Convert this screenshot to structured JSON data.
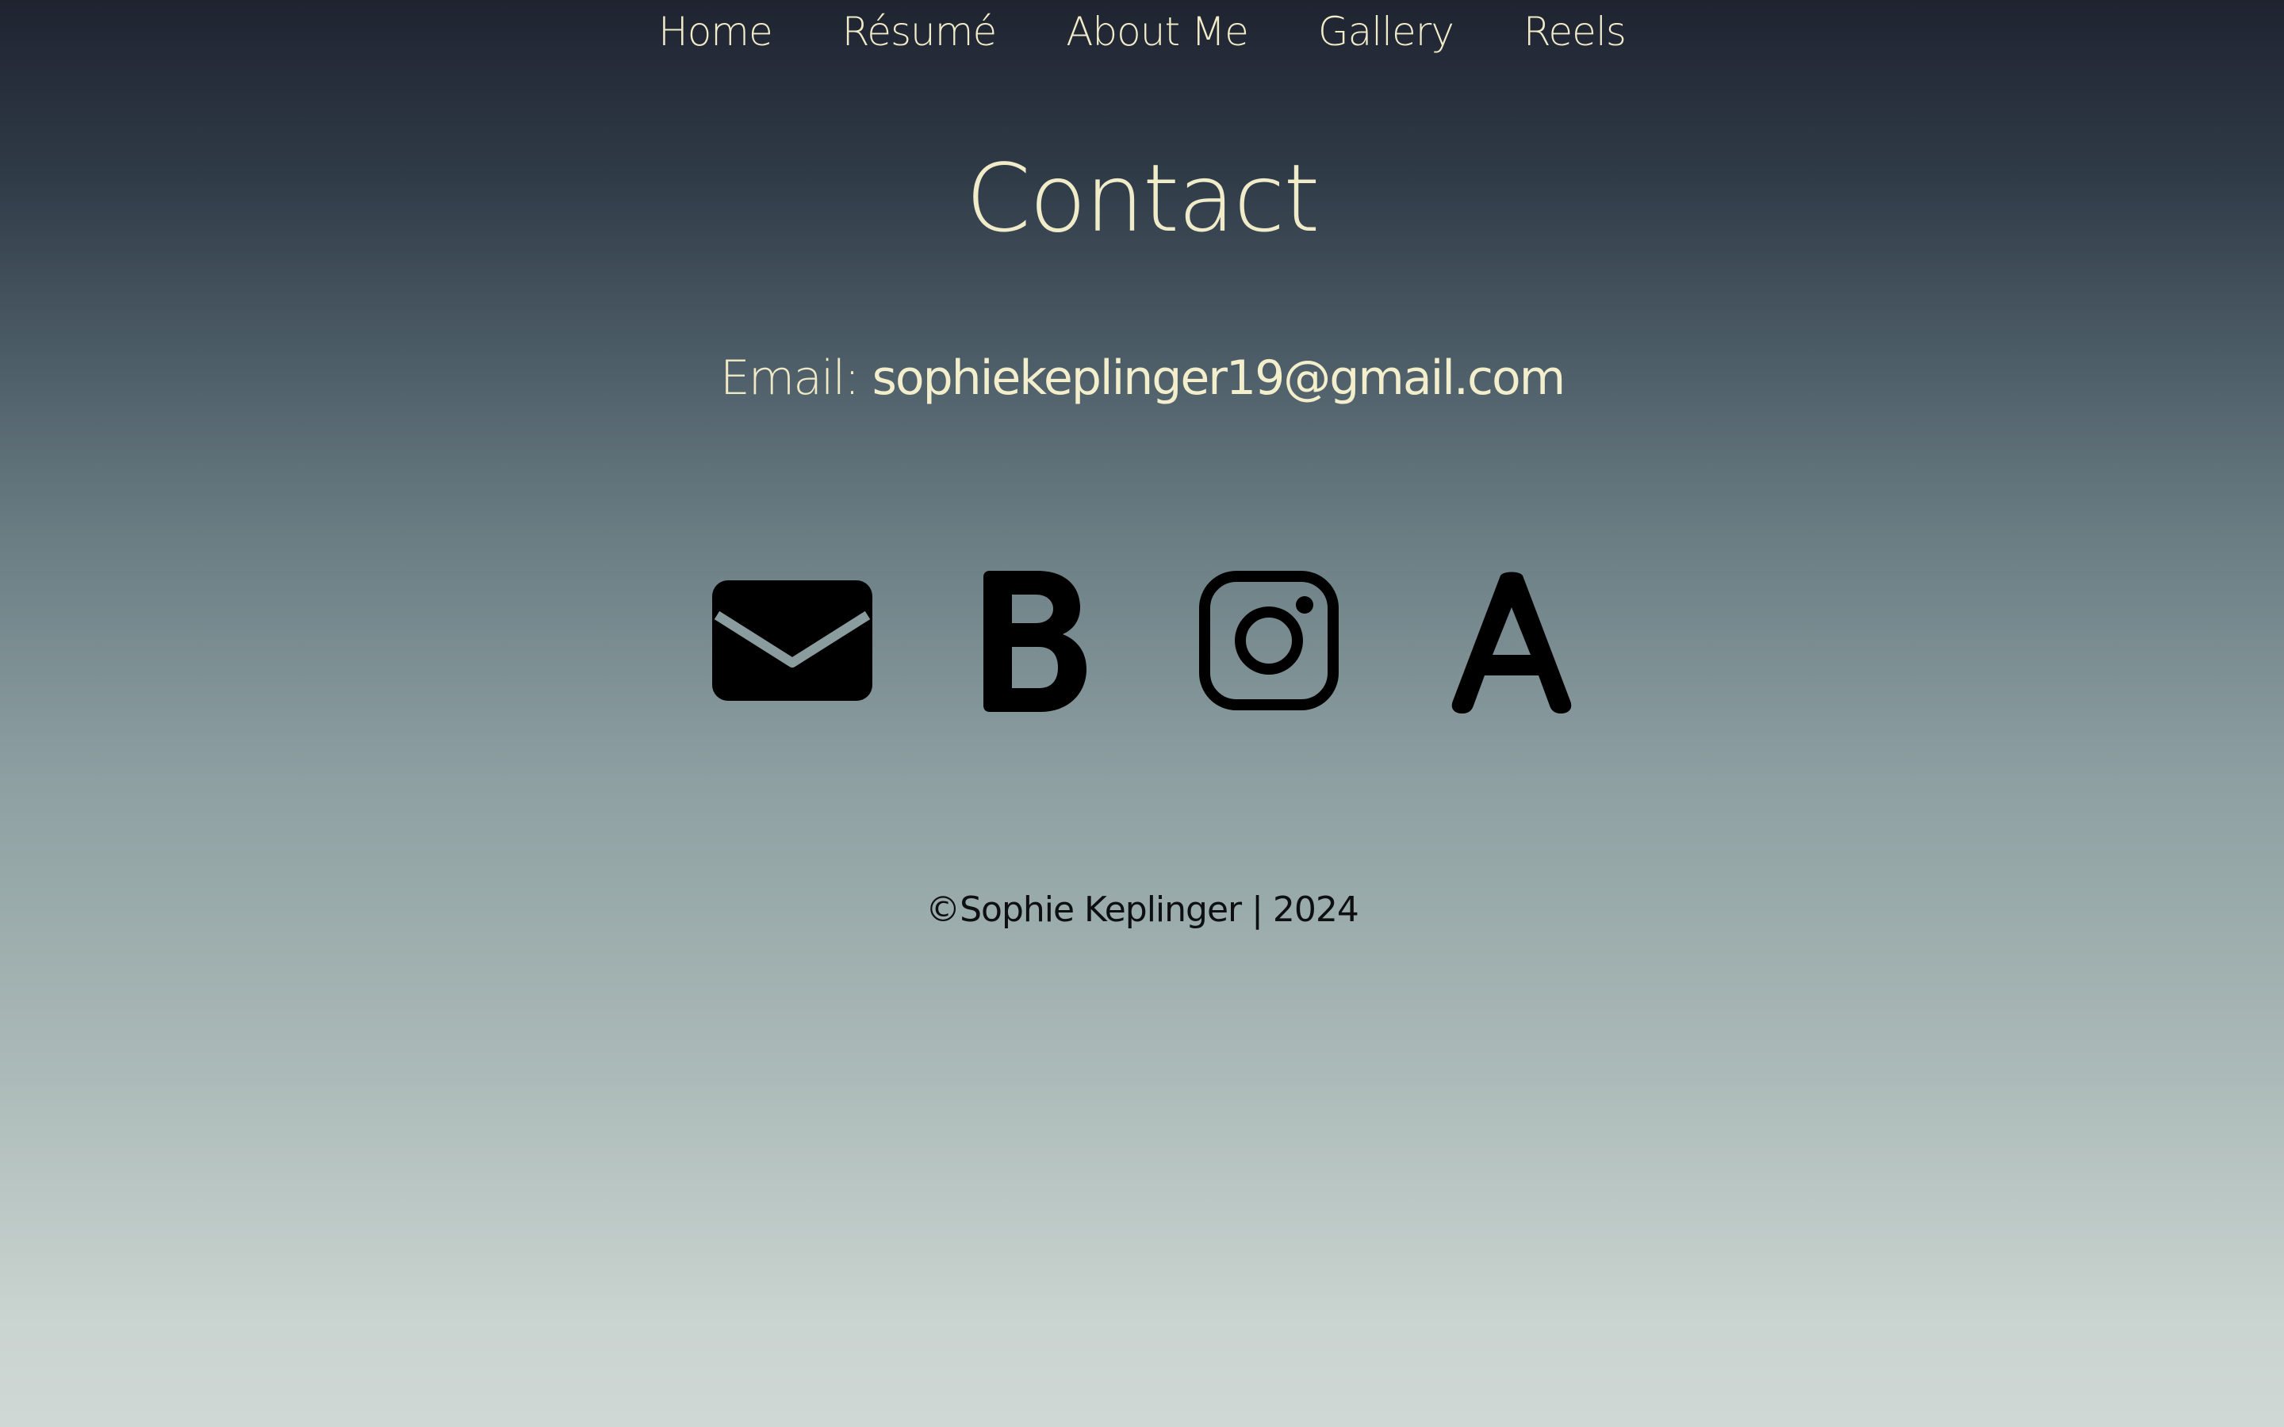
{
  "nav": {
    "items": [
      {
        "label": "Home"
      },
      {
        "label": "Résumé"
      },
      {
        "label": "About Me"
      },
      {
        "label": "Gallery"
      },
      {
        "label": "Reels"
      }
    ]
  },
  "page": {
    "title": "Contact"
  },
  "contact": {
    "email_label": "Email:",
    "email_address": "sophiekeplinger19@gmail.com"
  },
  "social": {
    "icons": [
      "envelope-icon",
      "letter-b-icon",
      "instagram-icon",
      "letter-a-icon"
    ]
  },
  "footer": {
    "text": "©Sophie Keplinger | 2024"
  },
  "colors": {
    "text_cream": "#f0ebc9",
    "footer_text": "#0d0f10",
    "icon_fill": "#000000"
  }
}
